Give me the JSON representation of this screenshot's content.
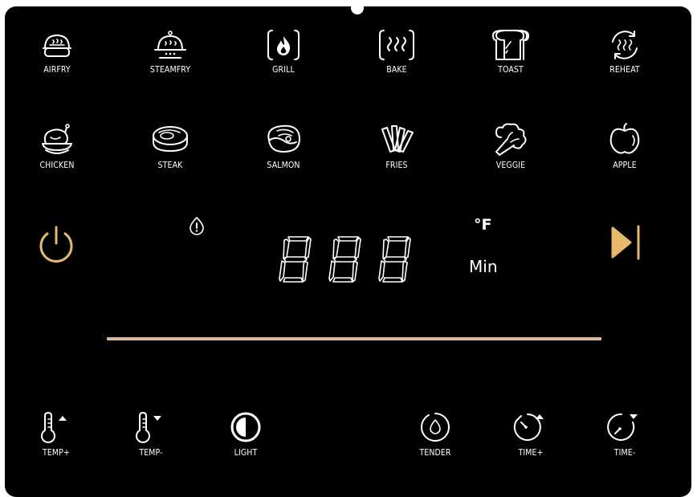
{
  "presets_row1": [
    {
      "label": "AIRFRY",
      "icon": "airfry-icon"
    },
    {
      "label": "STEAMFRY",
      "icon": "steamfry-icon"
    },
    {
      "label": "GRILL",
      "icon": "grill-flame-icon"
    },
    {
      "label": "BAKE",
      "icon": "bake-heat-icon"
    },
    {
      "label": "TOAST",
      "icon": "toast-icon"
    },
    {
      "label": "REHEAT",
      "icon": "reheat-icon"
    }
  ],
  "presets_row2": [
    {
      "label": "CHICKEN",
      "icon": "chicken-icon"
    },
    {
      "label": "STEAK",
      "icon": "steak-icon"
    },
    {
      "label": "SALMON",
      "icon": "salmon-icon"
    },
    {
      "label": "FRIES",
      "icon": "fries-icon"
    },
    {
      "label": "VEGGIE",
      "icon": "veggie-icon"
    },
    {
      "label": "APPLE",
      "icon": "apple-icon"
    }
  ],
  "display": {
    "digits": "888",
    "unit_temp": "°F",
    "unit_time": "Min"
  },
  "controls": [
    {
      "label": "TEMP+",
      "icon": "temp-up-icon"
    },
    {
      "label": "TEMP-",
      "icon": "temp-down-icon"
    },
    {
      "label": "LIGHT",
      "icon": "light-icon"
    },
    {
      "label": "TENDER",
      "icon": "tender-icon"
    },
    {
      "label": "TIME+",
      "icon": "time-up-icon"
    },
    {
      "label": "TIME-",
      "icon": "time-down-icon"
    }
  ],
  "colors": {
    "panel": "#000000",
    "accent_gold": "#e6b86a",
    "progress_bar": "#d8b8a2",
    "text": "#ffffff"
  }
}
